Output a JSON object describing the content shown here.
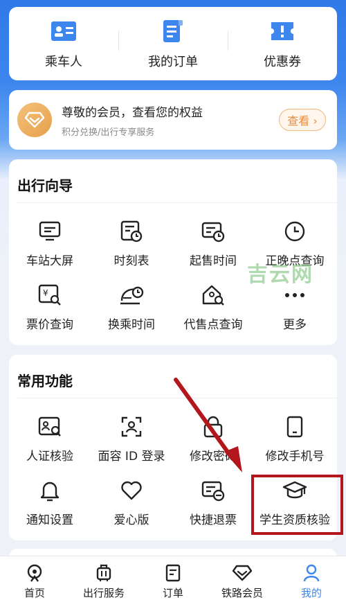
{
  "top_shortcuts": [
    {
      "label": "乘车人",
      "icon": "passenger-card-icon"
    },
    {
      "label": "我的订单",
      "icon": "orders-doc-icon"
    },
    {
      "label": "优惠券",
      "icon": "coupon-icon"
    }
  ],
  "member": {
    "title": "尊敬的会员，查看您的权益",
    "subtitle": "积分兑换/出行专享服务",
    "button": "查看 ›"
  },
  "guide": {
    "title": "出行向导",
    "items": [
      {
        "label": "车站大屏",
        "icon": "station-screen-icon"
      },
      {
        "label": "时刻表",
        "icon": "timetable-icon"
      },
      {
        "label": "起售时间",
        "icon": "sale-time-icon"
      },
      {
        "label": "正晚点查询",
        "icon": "clock-icon"
      },
      {
        "label": "票价查询",
        "icon": "fare-search-icon"
      },
      {
        "label": "换乘时间",
        "icon": "transfer-time-icon"
      },
      {
        "label": "代售点查询",
        "icon": "agency-search-icon"
      },
      {
        "label": "更多",
        "icon": "more-icon"
      }
    ]
  },
  "functions": {
    "title": "常用功能",
    "items": [
      {
        "label": "人证核验",
        "icon": "id-verify-icon"
      },
      {
        "label": "面容 ID 登录",
        "icon": "face-id-icon"
      },
      {
        "label": "修改密码",
        "icon": "lock-icon"
      },
      {
        "label": "修改手机号",
        "icon": "phone-icon"
      },
      {
        "label": "通知设置",
        "icon": "bell-icon"
      },
      {
        "label": "爱心版",
        "icon": "heart-icon"
      },
      {
        "label": "快捷退票",
        "icon": "refund-ticket-icon"
      },
      {
        "label": "学生资质核验",
        "icon": "graduation-cap-icon"
      }
    ]
  },
  "watermark": "吉云网",
  "bottom_nav": [
    {
      "label": "首页",
      "icon": "home-icon"
    },
    {
      "label": "出行服务",
      "icon": "luggage-icon"
    },
    {
      "label": "订单",
      "icon": "order-icon"
    },
    {
      "label": "铁路会员",
      "icon": "diamond-icon"
    },
    {
      "label": "我的",
      "icon": "profile-icon",
      "active": true
    }
  ],
  "colors": {
    "accent": "#3d86ee",
    "annotation": "#b3161b",
    "member_gold": "#e6a04d"
  }
}
